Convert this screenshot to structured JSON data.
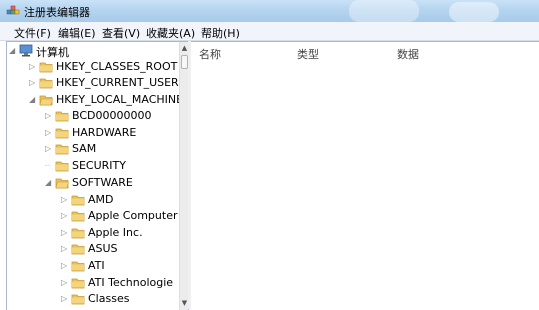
{
  "window": {
    "title": "注册表编辑器"
  },
  "menu": [
    "文件(F)",
    "编辑(E)",
    "查看(V)",
    "收藏夹(A)",
    "帮助(H)"
  ],
  "tree": [
    {
      "label": "计算机",
      "icon": "computer-icon",
      "state": "expanded",
      "level": 0
    },
    {
      "label": "HKEY_CLASSES_ROOT",
      "state": "collapsed",
      "level": 1
    },
    {
      "label": "HKEY_CURRENT_USER",
      "state": "collapsed",
      "level": 1
    },
    {
      "label": "HKEY_LOCAL_MACHINE",
      "state": "expanded",
      "level": 1
    },
    {
      "label": "BCD00000000",
      "state": "collapsed",
      "level": 2
    },
    {
      "label": "HARDWARE",
      "state": "collapsed",
      "level": 2
    },
    {
      "label": "SAM",
      "state": "collapsed",
      "level": 2
    },
    {
      "label": "SECURITY",
      "state": "leaf",
      "level": 2
    },
    {
      "label": "SOFTWARE",
      "state": "expanded",
      "level": 2
    },
    {
      "label": "AMD",
      "state": "collapsed",
      "level": 3
    },
    {
      "label": "Apple Computer",
      "state": "collapsed",
      "level": 3
    },
    {
      "label": "Apple Inc.",
      "state": "collapsed",
      "level": 3
    },
    {
      "label": "ASUS",
      "state": "collapsed",
      "level": 3
    },
    {
      "label": "ATI",
      "state": "collapsed",
      "level": 3
    },
    {
      "label": "ATI Technologie",
      "state": "collapsed",
      "level": 3
    },
    {
      "label": "Classes",
      "state": "collapsed",
      "level": 3
    }
  ],
  "columns": [
    "名称",
    "类型",
    "数据"
  ],
  "colors": {
    "folder": "#e9c15a",
    "folder_dark": "#c89a2e",
    "titlebar": "#b5d4ef"
  }
}
